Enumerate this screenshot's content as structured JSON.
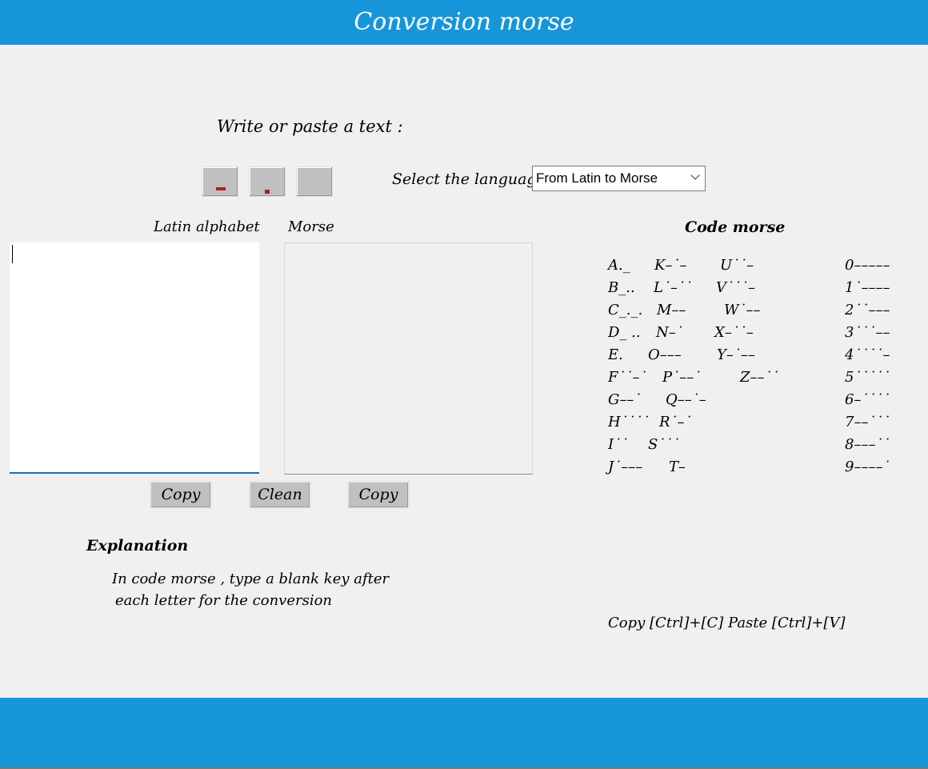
{
  "header": {
    "title": "Conversion morse"
  },
  "prompt": "Write or paste a text :",
  "keys": {
    "dash": "-",
    "dot": ".",
    "space": " "
  },
  "language": {
    "label": "Select the language",
    "selected": "From Latin to Morse"
  },
  "labels": {
    "latin": "Latin alphabet",
    "morse": "Morse"
  },
  "buttons": {
    "copy_left": "Copy",
    "clean": "Clean",
    "copy_right": "Copy"
  },
  "code_morse": {
    "title": "Code morse",
    "col1": [
      "A._",
      "B_..",
      "C_._.",
      "D_ ..",
      "E.",
      "F˙˙–˙",
      "G––˙",
      "H˙˙˙˙",
      "I˙˙",
      "J˙–––"
    ],
    "col2": [
      "K–˙–",
      "L˙–˙˙",
      "M––",
      "N–˙",
      "O–––",
      "P˙––˙",
      "Q––˙–",
      "R˙–˙",
      "S˙˙˙",
      "T–"
    ],
    "col3": [
      "U˙˙–",
      "V˙˙˙–",
      "W˙––",
      "X–˙˙–",
      "Y–˙––",
      "Z––˙˙"
    ],
    "digits": [
      "0–––––",
      "1˙––––",
      "2˙˙–––",
      "3˙˙˙––",
      "4˙˙˙˙–",
      "5˙˙˙˙˙",
      "6–˙˙˙˙",
      "7––˙˙˙",
      "8–––˙˙",
      "9––––˙"
    ]
  },
  "explanation": {
    "title": "Explanation",
    "line1": "In code morse , type a blank key after",
    "line2": "each letter for the conversion"
  },
  "shortcut": "Copy [Ctrl]+[C]  Paste [Ctrl]+[V]",
  "colors": {
    "accent": "#1696d9",
    "key_mark": "#b02020"
  }
}
